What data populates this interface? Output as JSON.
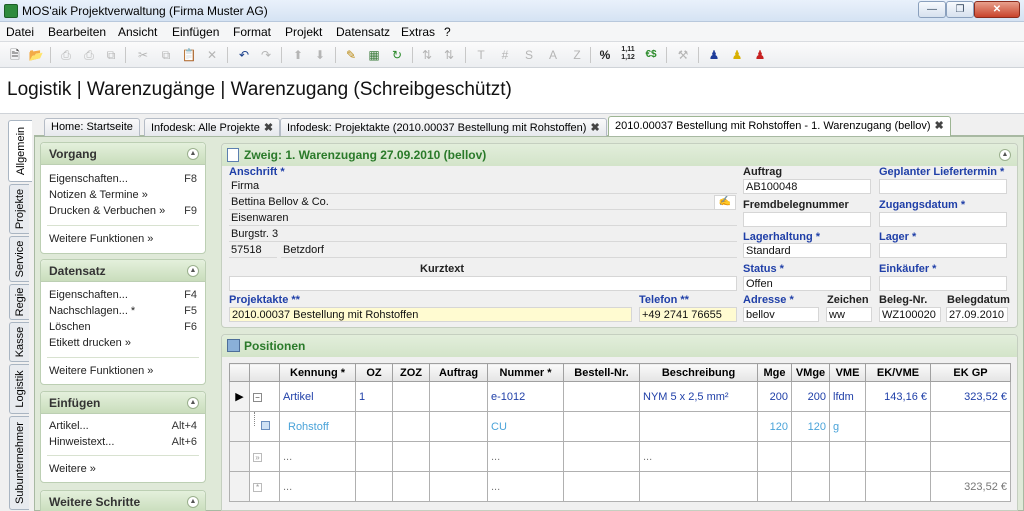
{
  "window": {
    "title": "MOS'aik Projektverwaltung (Firma Muster AG)"
  },
  "menu": [
    "Datei",
    "Bearbeiten",
    "Ansicht",
    "Einfügen",
    "Format",
    "Projekt",
    "Datensatz",
    "Extras",
    "?"
  ],
  "toolbar": {
    "text_items": [
      "T",
      "#",
      "S",
      "A",
      "Z",
      "%",
      "1,11 1,12",
      "€$"
    ]
  },
  "page_title": "Logistik | Warenzugänge | Warenzugang (Schreibgeschützt)",
  "vertical_tabs": [
    "Allgemein",
    "Projekte",
    "Service",
    "Regie",
    "Kasse",
    "Logistik",
    "Subunternehmer"
  ],
  "doc_tabs": [
    {
      "label": "Home: Startseite",
      "closable": false
    },
    {
      "label": "Infodesk: Alle Projekte",
      "closable": true
    },
    {
      "label": "Infodesk: Projektakte (2010.00037 Bestellung mit Rohstoffen)",
      "closable": true
    },
    {
      "label": "2010.00037 Bestellung mit Rohstoffen - 1. Warenzugang (bellov)",
      "closable": true,
      "active": true
    }
  ],
  "close_glyph": "✖",
  "left_panel": {
    "vorgang": {
      "title": "Vorgang",
      "items": [
        {
          "label": "Eigenschaften...",
          "shortcut": "F8"
        },
        {
          "label": "Notizen & Termine »",
          "shortcut": ""
        },
        {
          "label": "Drucken & Verbuchen »",
          "shortcut": "F9"
        }
      ],
      "more": "Weitere Funktionen »"
    },
    "datensatz": {
      "title": "Datensatz",
      "items": [
        {
          "label": "Eigenschaften...",
          "shortcut": "F4"
        },
        {
          "label": "Nachschlagen... *",
          "shortcut": "F5"
        },
        {
          "label": "Löschen",
          "shortcut": "F6"
        },
        {
          "label": "Etikett drucken »",
          "shortcut": ""
        }
      ],
      "more": "Weitere Funktionen »"
    },
    "einfuegen": {
      "title": "Einfügen",
      "items": [
        {
          "label": "Artikel...",
          "shortcut": "Alt+4"
        },
        {
          "label": "Hinweistext...",
          "shortcut": "Alt+6"
        }
      ],
      "more": "Weitere »"
    },
    "weitere_schritte": {
      "title": "Weitere Schritte"
    }
  },
  "form": {
    "title": "Zweig: 1. Warenzugang 27.09.2010 (bellov)",
    "anschrift_label": "Anschrift *",
    "anschrift_lines": [
      "Firma",
      "Bettina Bellov & Co.",
      "Eisenwaren",
      "Burgstr. 3"
    ],
    "plz": "57518",
    "ort": "Betzdorf",
    "kurztext_label": "Kurztext",
    "kurztext_value": "",
    "auftrag_label": "Auftrag",
    "auftrag_value": "AB100048",
    "fremdbelegnummer_label": "Fremdbelegnummer",
    "fremdbelegnummer_value": "",
    "lagerhaltung_label": "Lagerhaltung *",
    "lagerhaltung_value": "Standard",
    "status_label": "Status *",
    "status_value": "Offen",
    "geplanter_liefertermin_label": "Geplanter Liefertermin *",
    "geplanter_liefertermin_value": "",
    "zugangsdatum_label": "Zugangsdatum *",
    "zugangsdatum_value": "",
    "lager_label": "Lager *",
    "lager_value": "",
    "einkaeufer_label": "Einkäufer *",
    "einkaeufer_value": "",
    "projektakte_label": "Projektakte **",
    "projektakte_value": "2010.00037 Bestellung mit Rohstoffen",
    "telefon_label": "Telefon **",
    "telefon_value": "+49 2741 76655",
    "adresse_label": "Adresse *",
    "adresse_value": "bellov",
    "zeichen_label": "Zeichen",
    "zeichen_value": "ww",
    "belegnr_label": "Beleg-Nr.",
    "belegnr_value": "WZ100020",
    "belegdatum_label": "Belegdatum",
    "belegdatum_value": "27.09.2010"
  },
  "positionen": {
    "title": "Positionen",
    "columns": [
      "Kennung *",
      "OZ",
      "ZOZ",
      "Auftrag",
      "Nummer *",
      "Bestell-Nr.",
      "Beschreibung",
      "Mge",
      "VMge",
      "VME",
      "EK/VME",
      "EK GP"
    ],
    "rows": [
      {
        "kennung": "Artikel",
        "oz": "1",
        "zoz": "",
        "auftrag": "",
        "nummer": "e-1012",
        "bestell": "",
        "beschreibung": "NYM 5 x 2,5 mm²",
        "mge": "200",
        "vmge": "200",
        "vme": "lfdm",
        "ek_vme": "143,16 €",
        "ek_gp": "323,52 €"
      },
      {
        "kennung": "Rohstoff",
        "oz": "",
        "zoz": "",
        "auftrag": "",
        "nummer": "CU",
        "bestell": "",
        "beschreibung": "",
        "mge": "120",
        "vmge": "120",
        "vme": "g",
        "ek_vme": "",
        "ek_gp": ""
      },
      {
        "kennung": "...",
        "oz": "",
        "zoz": "",
        "auftrag": "",
        "nummer": "...",
        "bestell": "",
        "beschreibung": "...",
        "mge": "",
        "vmge": "",
        "vme": "",
        "ek_vme": "",
        "ek_gp": ""
      },
      {
        "kennung": "...",
        "oz": "",
        "zoz": "",
        "auftrag": "",
        "nummer": "...",
        "bestell": "",
        "beschreibung": "",
        "mge": "",
        "vmge": "",
        "vme": "",
        "ek_vme": "",
        "ek_gp": "323,52 €"
      }
    ]
  }
}
